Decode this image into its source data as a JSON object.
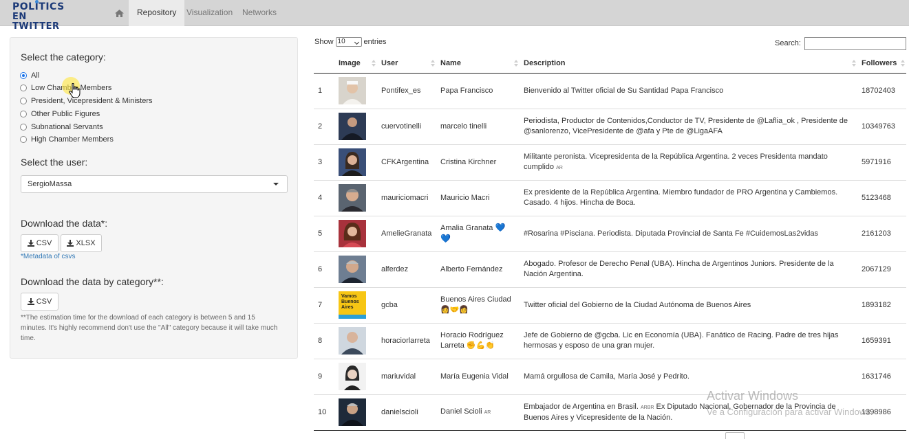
{
  "nav": {
    "logo_line1": "POLITICS",
    "logo_line2": "EN TWITTER",
    "tabs": [
      {
        "label": "Repository",
        "active": true
      },
      {
        "label": "Visualization",
        "active": false
      },
      {
        "label": "Networks",
        "active": false
      }
    ]
  },
  "sidebar": {
    "category_label": "Select the category:",
    "categories": [
      {
        "label": "All",
        "selected": true
      },
      {
        "label": "Low Chamber Members",
        "selected": false
      },
      {
        "label": "President, Vicepresident & Ministers",
        "selected": false
      },
      {
        "label": "Other Public Figures",
        "selected": false
      },
      {
        "label": "Subnational Servants",
        "selected": false
      },
      {
        "label": "High Chamber Members",
        "selected": false
      }
    ],
    "user_label": "Select the user:",
    "user_value": "SergioMassa",
    "download_label": "Download the data*:",
    "csv_label": "CSV",
    "xlsx_label": "XLSX",
    "metadata_link": "*Metadata of csvs",
    "download_cat_label": "Download the data by category**:",
    "csv_cat_label": "CSV",
    "note": "**The estimation time for the download of each category is between 5 and 15 minutes. It's highly recommend don't use the \"All\" category because it will take much time."
  },
  "table": {
    "show_label": "Show",
    "entries_value": "10",
    "entries_label": "entries",
    "search_label": "Search:",
    "headers": [
      "",
      "Image",
      "User",
      "Name",
      "Description",
      "Followers"
    ],
    "rows": [
      {
        "n": "1",
        "user": "Pontifex_es",
        "name": "Papa Francisco",
        "desc": "Bienvenido al Twitter oficial de Su Santidad Papa Francisco",
        "followers": "18702403"
      },
      {
        "n": "2",
        "user": "cuervotinelli",
        "name": "marcelo tinelli",
        "desc": "Periodista, Productor de Contenidos,Conductor de TV, Presidente de @Laflia_ok , Presidente de @sanlorenzo, VicePresidente de @afa y Pte de @LigaAFA",
        "followers": "10349763"
      },
      {
        "n": "3",
        "user": "CFKArgentina",
        "name": "Cristina Kirchner",
        "desc": "Militante peronista. Vicepresidenta de la República Argentina. 2 veces Presidenta mandato cumplido",
        "desc_flag": "AR",
        "followers": "5971916"
      },
      {
        "n": "4",
        "user": "mauriciomacri",
        "name": "Mauricio Macri",
        "desc": "Ex presidente de la República Argentina. Miembro fundador de PRO Argentina y Cambiemos. Casado. 4 hijos. Hincha de Boca.",
        "followers": "5123468"
      },
      {
        "n": "5",
        "user": "AmelieGranata",
        "name": "Amalia Granata",
        "name_emoji": "💙💙",
        "desc": "#Rosarina #Pisciana. Periodista. Diputada Provincial de Santa Fe #CuidemosLas2vidas",
        "followers": "2161203"
      },
      {
        "n": "6",
        "user": "alferdez",
        "name": "Alberto Fernández",
        "desc": "Abogado. Profesor de Derecho Penal (UBA). Hincha de Argentinos Juniors. Presidente de la Nación Argentina.",
        "followers": "2067129"
      },
      {
        "n": "7",
        "user": "gcba",
        "name": "Buenos Aires Ciudad",
        "name_emoji": "👩‍🤝‍👩",
        "desc": "Twitter oficial del Gobierno de la Ciudad Autónoma de Buenos Aires",
        "followers": "1893182"
      },
      {
        "n": "8",
        "user": "horaciorlarreta",
        "name": "Horacio Rodríguez Larreta",
        "name_emoji": "✊💪👏",
        "desc": "Jefe de Gobierno de @gcba. Lic en Economía (UBA). Fanático de Racing. Padre de tres hijas hermosas y esposo de una gran mujer.",
        "followers": "1659391"
      },
      {
        "n": "9",
        "user": "mariuvidal",
        "name": "María Eugenia Vidal",
        "desc": "Mamá orgullosa de Camila, María José y Pedrito.",
        "followers": "1631746"
      },
      {
        "n": "10",
        "user": "danielscioli",
        "name": "Daniel Scioli",
        "name_flag": "AR",
        "desc_part1": "Embajador de Argentina en Brasil.",
        "desc_flags": "ARBR",
        "desc_part2": "Ex Diputado Nacional, Gobernador de la Provincia de Buenos Aires y Vicepresidente de la Nación.",
        "followers": "1398986"
      }
    ],
    "gcba_logo_text": "Vamos Buenos Aires"
  },
  "watermark": {
    "line1": "Activar Windows",
    "line2": "Ve a Configuración para activar Windows."
  },
  "colors": {
    "navbar": "#d5d5d5",
    "logo": "#1c3a78",
    "link": "#337ab7",
    "radio_on": "#1a73e8",
    "heart": "#1e6fd0"
  }
}
